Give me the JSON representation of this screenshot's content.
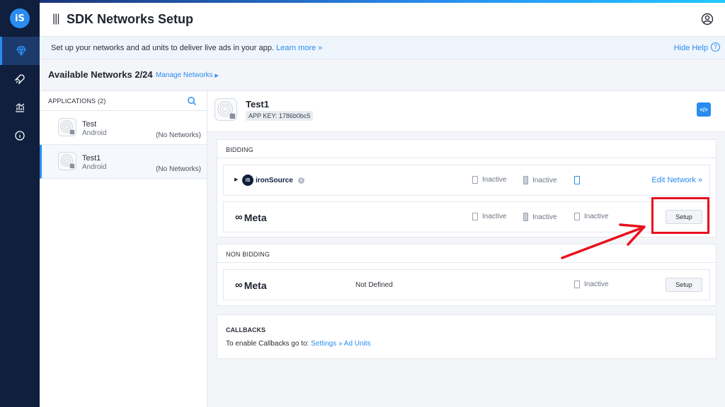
{
  "app": {
    "title": "SDK Networks Setup",
    "logo_text": "iS"
  },
  "rail": {
    "items": [
      {
        "icon": "diamond-icon",
        "active": true
      },
      {
        "icon": "rocket-icon",
        "active": false
      },
      {
        "icon": "analytics-icon",
        "active": false
      },
      {
        "icon": "info-icon",
        "active": false
      }
    ]
  },
  "infobar": {
    "message": "Set up your networks and ad units to deliver live ads in your app.",
    "learn_more": "Learn more »",
    "hide_help": "Hide Help",
    "help_icon": "?"
  },
  "networks_bar": {
    "count_label": "Available Networks 2/24",
    "manage_label": "Manage Networks"
  },
  "applications": {
    "header": "APPLICATIONS (2)",
    "items": [
      {
        "name": "Test",
        "platform": "Android",
        "networks": "(No Networks)",
        "selected": false
      },
      {
        "name": "Test1",
        "platform": "Android",
        "networks": "(No Networks)",
        "selected": true
      }
    ]
  },
  "selected_app": {
    "name": "Test1",
    "app_key": "APP KEY: 1786b0bc5",
    "code_button": "</>"
  },
  "bidding": {
    "title": "BIDDING",
    "rows": [
      {
        "network_mark": "iS",
        "network": "ironSource",
        "info": "i",
        "status_1": "Inactive",
        "status_2": "Inactive",
        "action": "Edit Network »"
      },
      {
        "network": "Meta",
        "network_mark": "∞",
        "status_1": "Inactive",
        "status_2": "Inactive",
        "status_3": "Inactive",
        "action": "Setup"
      }
    ]
  },
  "non_bidding": {
    "title": "NON BIDDING",
    "rows": [
      {
        "network": "Meta",
        "network_mark": "∞",
        "defined": "Not Defined",
        "status_3": "Inactive",
        "action": "Setup"
      }
    ]
  },
  "callbacks": {
    "title": "CALLBACKS",
    "text": "To enable Callbacks go to:",
    "link": "Settings » Ad Units"
  },
  "colors": {
    "accent": "#2a8cf0",
    "rail": "#0f1f3d",
    "highlight": "#e8111d"
  }
}
